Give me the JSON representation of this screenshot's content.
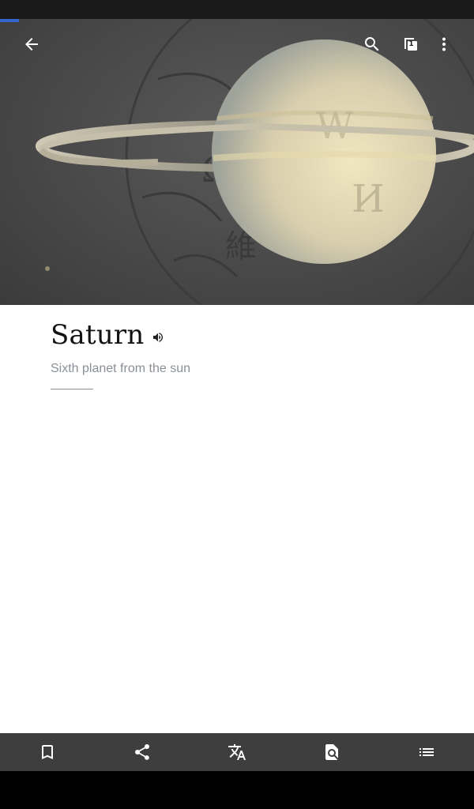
{
  "load_progress": 0.04,
  "toolbar": {
    "back_icon": "arrow-back-icon",
    "search_icon": "search-icon",
    "tabs_icon": "tabs-icon",
    "tab_count": "1",
    "overflow_icon": "more-vert-icon"
  },
  "hero": {
    "image_subject": "Saturn with rings over Wikipedia globe watermark"
  },
  "article": {
    "title": "Saturn",
    "description": "Sixth planet from the sun",
    "listen_icon": "speaker-icon"
  },
  "bottom_bar": {
    "items": [
      {
        "icon": "bookmark-icon"
      },
      {
        "icon": "share-icon"
      },
      {
        "icon": "translate-icon"
      },
      {
        "icon": "find-in-page-icon"
      },
      {
        "icon": "contents-list-icon"
      }
    ]
  },
  "colors": {
    "accent": "#3366cc",
    "toolbar_bg": "#3e3e3e",
    "title_text": "#111111",
    "description_text": "#8a8f96"
  }
}
